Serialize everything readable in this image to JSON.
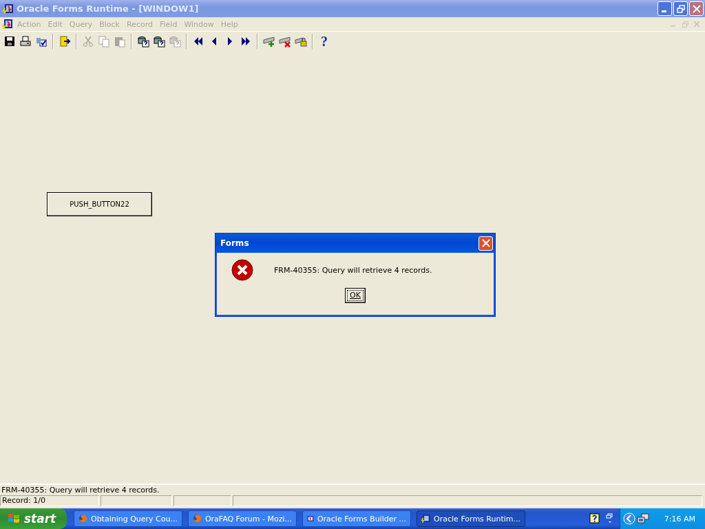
{
  "window": {
    "title": "Oracle Forms Runtime - [WINDOW1]",
    "active": false
  },
  "menu": [
    {
      "label": "Action",
      "disabled": true
    },
    {
      "label": "Edit",
      "disabled": true
    },
    {
      "label": "Query",
      "disabled": true
    },
    {
      "label": "Block",
      "disabled": true
    },
    {
      "label": "Record",
      "disabled": true
    },
    {
      "label": "Field",
      "disabled": true
    },
    {
      "label": "Window",
      "disabled": true
    },
    {
      "label": "Help",
      "disabled": true
    }
  ],
  "toolbar": [
    {
      "kind": "save",
      "disabled": false
    },
    {
      "kind": "print",
      "disabled": false
    },
    {
      "kind": "clear",
      "disabled": false
    },
    {
      "kind": "separator"
    },
    {
      "kind": "exit",
      "disabled": false
    },
    {
      "kind": "separator"
    },
    {
      "kind": "cut",
      "disabled": true
    },
    {
      "kind": "copy",
      "disabled": true
    },
    {
      "kind": "paste",
      "disabled": true
    },
    {
      "kind": "separator"
    },
    {
      "kind": "enter-query",
      "disabled": false
    },
    {
      "kind": "execute-query",
      "disabled": false
    },
    {
      "kind": "cancel-query",
      "disabled": true
    },
    {
      "kind": "separator"
    },
    {
      "kind": "prev-block",
      "disabled": false
    },
    {
      "kind": "prev-record",
      "disabled": false
    },
    {
      "kind": "next-record",
      "disabled": false
    },
    {
      "kind": "next-block",
      "disabled": false
    },
    {
      "kind": "separator"
    },
    {
      "kind": "insert-record",
      "disabled": false
    },
    {
      "kind": "delete-record",
      "disabled": false
    },
    {
      "kind": "lock-record",
      "disabled": false
    },
    {
      "kind": "separator"
    },
    {
      "kind": "help",
      "label": "?",
      "disabled": false
    }
  ],
  "canvas": {
    "push_button": "PUSH_BUTTON22"
  },
  "dialog": {
    "title": "Forms",
    "message": "FRM-40355: Query will retrieve 4 records.",
    "button": "OK"
  },
  "status_bar": {
    "message": "FRM-40355: Query will retrieve 4 records.",
    "record": "Record: 1/0"
  },
  "taskbar": {
    "start": "start",
    "tasks": [
      {
        "label": "Obtaining Query Cou...",
        "kind": "browser",
        "selected": false
      },
      {
        "label": "OraFAQ Forum - Mozi...",
        "kind": "browser",
        "selected": false
      },
      {
        "label": "Oracle Forms Builder ...",
        "kind": "builder",
        "selected": false
      },
      {
        "label": "Oracle Forms Runtim...",
        "kind": "runtime",
        "selected": true
      }
    ],
    "clock": "7:16 AM"
  }
}
